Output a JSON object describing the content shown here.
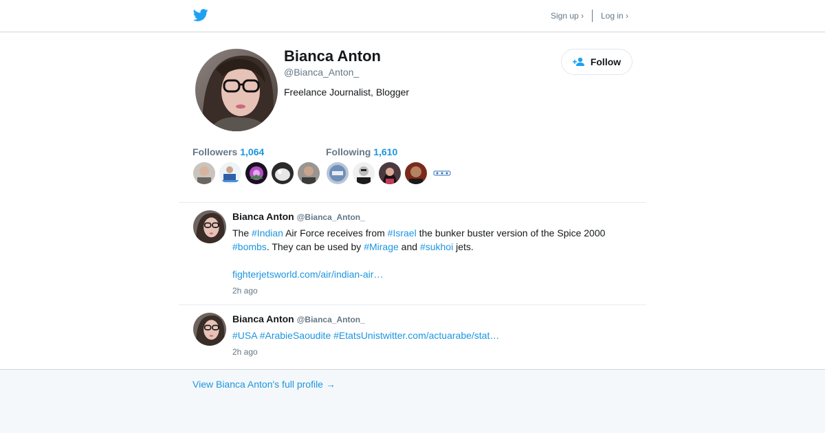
{
  "header": {
    "signup_label": "Sign up ›",
    "login_label": "Log in ›"
  },
  "profile": {
    "name": "Bianca Anton",
    "handle": "@Bianca_Anton_",
    "bio": "Freelance Journalist, Blogger",
    "follow_label": "Follow"
  },
  "stats": {
    "followers_label": "Followers",
    "followers_count": "1,064",
    "following_label": "Following",
    "following_count": "1,610"
  },
  "tweets": [
    {
      "name": "Bianca Anton",
      "handle": "@Bianca_Anton_",
      "text": {
        "t1": "The ",
        "tag1": "#Indian",
        "t2": " Air Force receives from ",
        "tag2": "#Israel",
        "t3": " the bunker buster version of the Spice 2000 ",
        "tag3": "#bombs",
        "t4": ". They can be used by ",
        "tag4": "#Mirage",
        "t5": " and ",
        "tag5": "#sukhoi",
        "t6": " jets."
      },
      "link": "fighterjetsworld.com/air/indian-air…",
      "time": "2h ago"
    },
    {
      "name": "Bianca Anton",
      "handle": "@Bianca_Anton_",
      "text": {
        "tag1": "#USA",
        "t1": " ",
        "tag2": "#ArabieSaoudite",
        "t2": " ",
        "tag3": "#EtatsUnis",
        "link": "twitter.com/actuarabe/stat…"
      },
      "time": "2h ago"
    }
  ],
  "footer": {
    "full_profile_label": "View Bianca Anton's full profile →"
  },
  "colors": {
    "brand_blue": "#1da1f2",
    "link_blue": "#1b95e0",
    "muted_gray": "#657786"
  },
  "icons": [
    "twitter-bird-icon",
    "add-user-icon"
  ]
}
